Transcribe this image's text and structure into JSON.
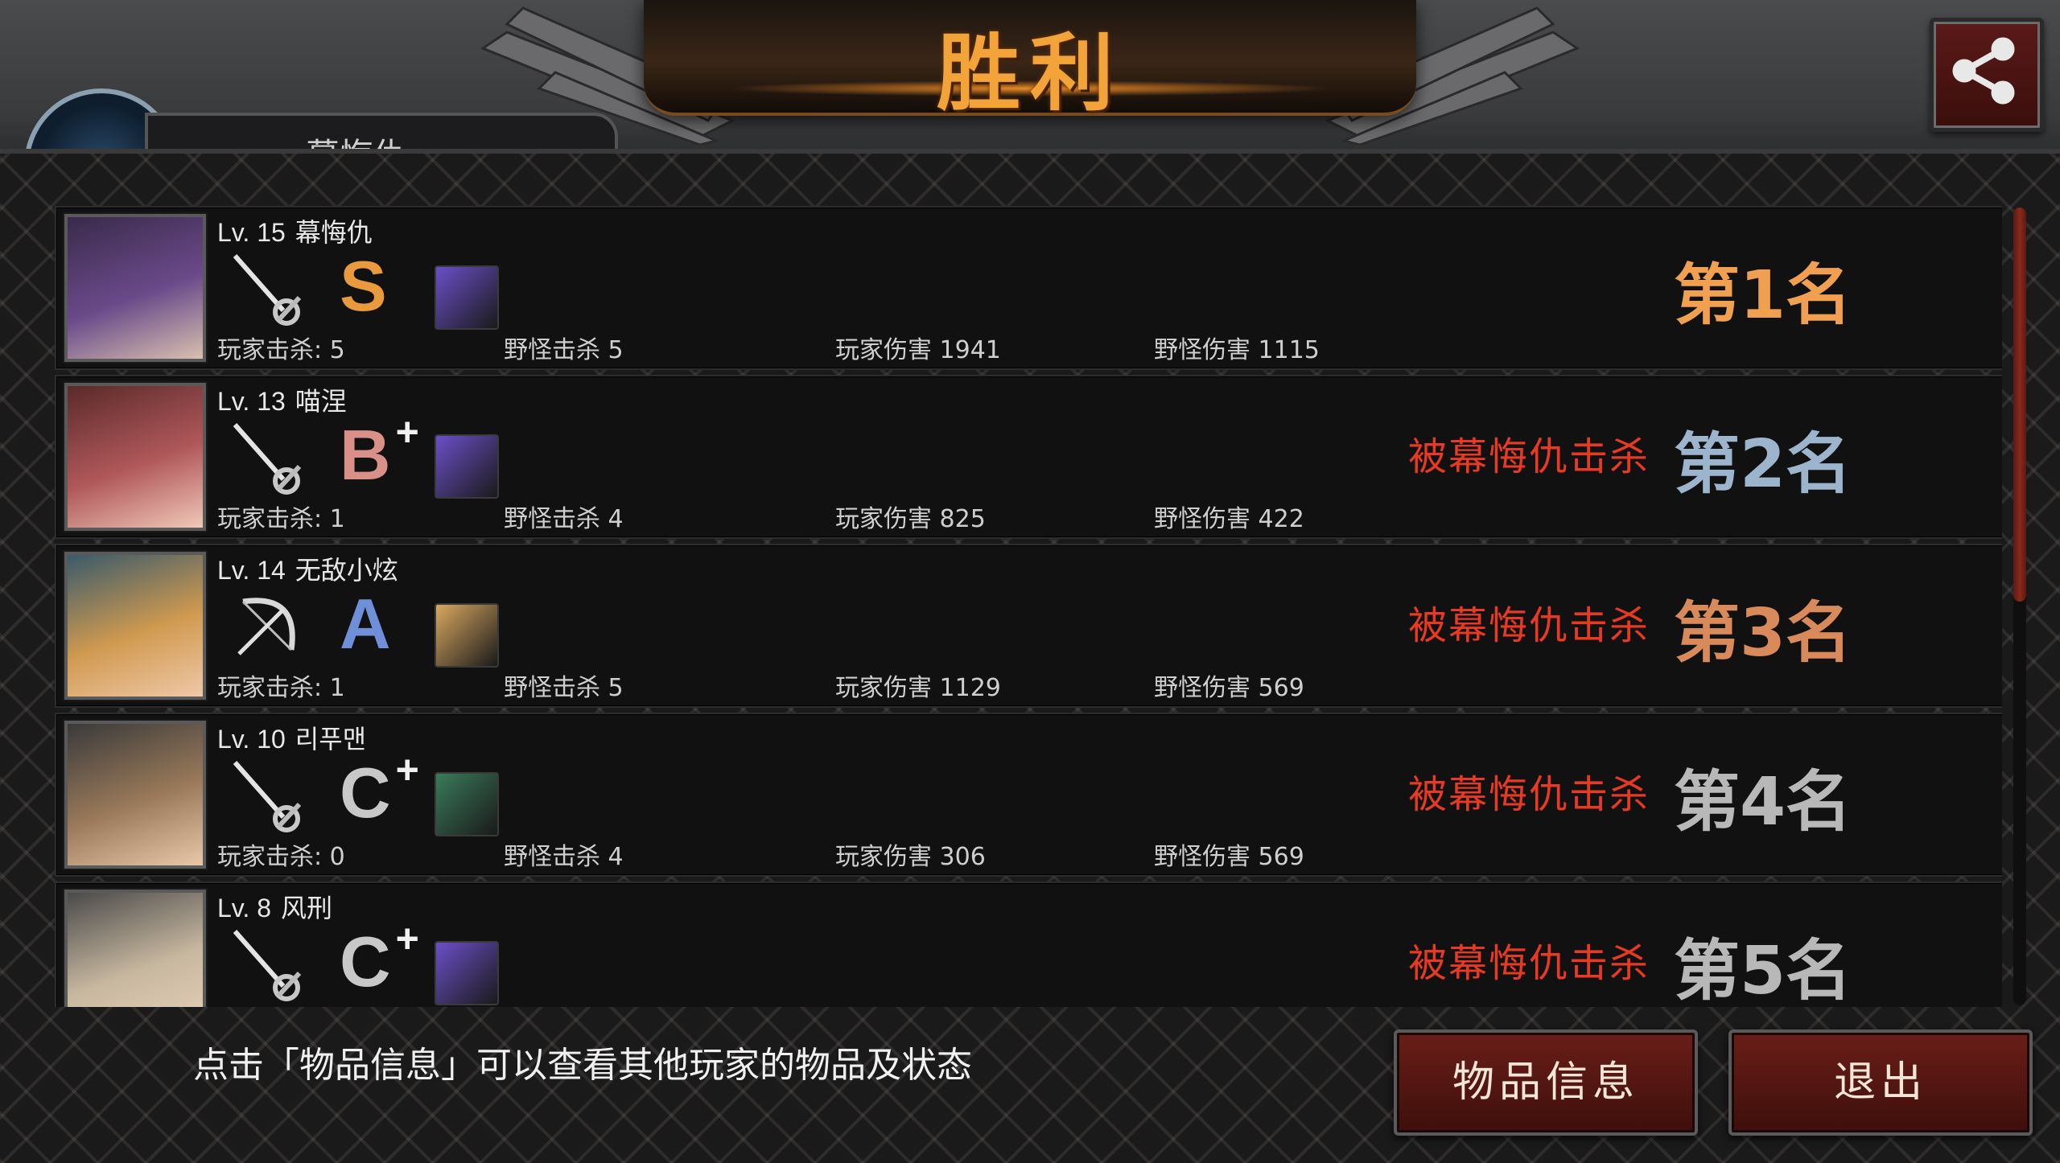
{
  "header": {
    "title": "胜利",
    "player_chip_name": "幕悔仇"
  },
  "share_icon": "share-icon",
  "players": [
    {
      "level": "Lv. 15",
      "name": "幕悔仇",
      "weapon": "rapier-icon",
      "grade": "S",
      "grade_plus": "",
      "grade_color": "#e89a3c",
      "item_color": "#6a4fc8",
      "player_kills": "玩家击杀: 5",
      "monster_kills": "野怪击杀 5",
      "player_damage": "玩家伤害 1941",
      "monster_damage": "野怪伤害 1115",
      "status": "",
      "rank": "第1名",
      "rank_color": "#f0a050"
    },
    {
      "level": "Lv. 13",
      "name": "喵涅",
      "weapon": "rapier-icon",
      "grade": "B",
      "grade_plus": "+",
      "grade_color": "#d89088",
      "item_color": "#6a4fc8",
      "player_kills": "玩家击杀: 1",
      "monster_kills": "野怪击杀 4",
      "player_damage": "玩家伤害 825",
      "monster_damage": "野怪伤害 422",
      "status": "被幕悔仇击杀",
      "rank": "第2名",
      "rank_color": "#9cb4cc"
    },
    {
      "level": "Lv. 14",
      "name": "无敌小炫",
      "weapon": "bow-icon",
      "grade": "A",
      "grade_plus": "",
      "grade_color": "#6f90d8",
      "item_color": "#d8a860",
      "player_kills": "玩家击杀: 1",
      "monster_kills": "野怪击杀 5",
      "player_damage": "玩家伤害 1129",
      "monster_damage": "野怪伤害 569",
      "status": "被幕悔仇击杀",
      "rank": "第3名",
      "rank_color": "#d88a5a"
    },
    {
      "level": "Lv. 10",
      "name": "리푸맨",
      "weapon": "rapier-icon",
      "grade": "C",
      "grade_plus": "+",
      "grade_color": "#c8c8c8",
      "item_color": "#3a7a5a",
      "player_kills": "玩家击杀: 0",
      "monster_kills": "野怪击杀 4",
      "player_damage": "玩家伤害 306",
      "monster_damage": "野怪伤害 569",
      "status": "被幕悔仇击杀",
      "rank": "第4名",
      "rank_color": "#b8b8b8"
    },
    {
      "level": "Lv. 8",
      "name": "风刑",
      "weapon": "rapier-icon",
      "grade": "C",
      "grade_plus": "+",
      "grade_color": "#c8c8c8",
      "item_color": "#6a4fc8",
      "player_kills": "",
      "monster_kills": "",
      "player_damage": "",
      "monster_damage": "",
      "status": "被幕悔仇击杀",
      "rank": "第5名",
      "rank_color": "#b8b8b8"
    }
  ],
  "footer": {
    "hint": "点击「物品信息」可以查看其他玩家的物品及状态",
    "item_info_label": "物品信息",
    "exit_label": "退出"
  }
}
